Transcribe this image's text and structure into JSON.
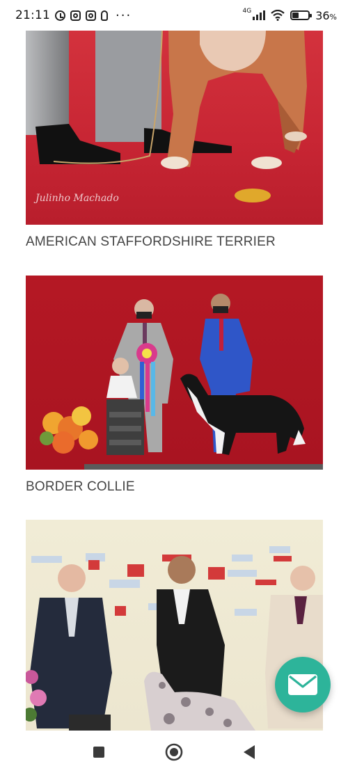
{
  "status_bar": {
    "time": "21:11",
    "network": "4G",
    "battery_percent": 36,
    "battery_label": "36",
    "battery_unit": "%",
    "more": "···",
    "icons": [
      "alarm-icon",
      "instagram-icon",
      "instagram-icon",
      "bulb-icon"
    ]
  },
  "feed": {
    "items": [
      {
        "caption": "AMERICAN STAFFORDSHIRE TERRIER",
        "photo_watermark": "Julinho Machado"
      },
      {
        "caption": "BORDER COLLIE"
      },
      {
        "caption": ""
      }
    ]
  },
  "fab": {
    "icon": "mail-icon",
    "color": "#2db49a"
  },
  "nav_bar": {
    "buttons": [
      "recent-apps-icon",
      "home-icon",
      "back-icon"
    ]
  },
  "colors": {
    "show_red": "#c72533",
    "accent_green": "#2db49a",
    "caption_text": "#444444"
  }
}
